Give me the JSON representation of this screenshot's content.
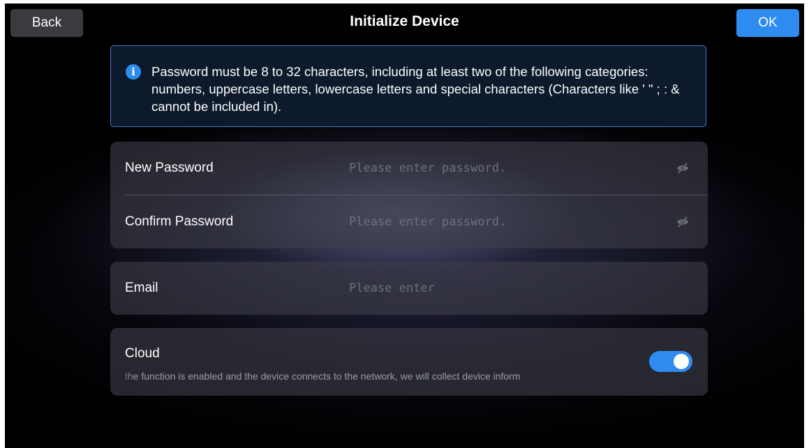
{
  "header": {
    "back_label": "Back",
    "title": "Initialize Device",
    "ok_label": "OK"
  },
  "info": {
    "icon": "info-icon",
    "icon_glyph": "i",
    "text": "Password must be 8 to 32 characters, including at least two of the following categories: numbers, uppercase letters, lowercase letters and special characters (Characters like ' \" ; : & cannot be included in)."
  },
  "password_card": {
    "new_password": {
      "label": "New Password",
      "value": "",
      "placeholder": "Please enter password.",
      "icon": "eye-off-icon"
    },
    "confirm_password": {
      "label": "Confirm Password",
      "value": "",
      "placeholder": "Please enter password.",
      "icon": "eye-off-icon"
    }
  },
  "email_card": {
    "label": "Email",
    "value": "",
    "placeholder": "Please enter"
  },
  "cloud_card": {
    "label": "Cloud",
    "description": "the function is enabled and the device connects to the network, we will collect device inform",
    "enabled": true
  },
  "colors": {
    "accent": "#2e8cf0",
    "info_border": "#3f7bd0",
    "back_button": "#3a3b3f",
    "background": "#000000"
  }
}
